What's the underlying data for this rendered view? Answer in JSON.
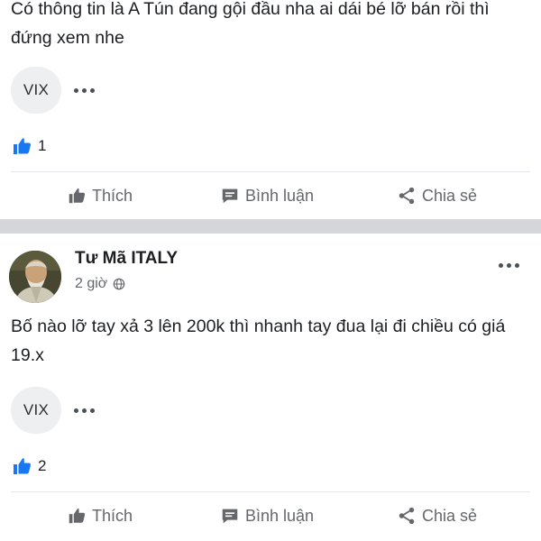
{
  "post1": {
    "text": "Có thông tin là A Tún đang gội đầu nha ai dái bé lỡ bán rồi thì đứng xem nhe",
    "tag": "VIX",
    "like_count": "1"
  },
  "post2": {
    "author": "Tư Mã ITALY",
    "time": "2 giờ",
    "text": "Bố nào lỡ tay xả 3 lên 200k thì nhanh tay đua lại đi chiều có giá 19.x",
    "tag": "VIX",
    "like_count": "2"
  },
  "actions": {
    "like": "Thích",
    "comment": "Bình luận",
    "share": "Chia sẻ"
  },
  "colors": {
    "like_blue": "#1877f2",
    "muted_text": "#65676b",
    "separator": "#d5d6da"
  },
  "icons": [
    "thumbs-up-icon",
    "comment-icon",
    "share-icon",
    "more-options-icon",
    "globe-icon"
  ]
}
